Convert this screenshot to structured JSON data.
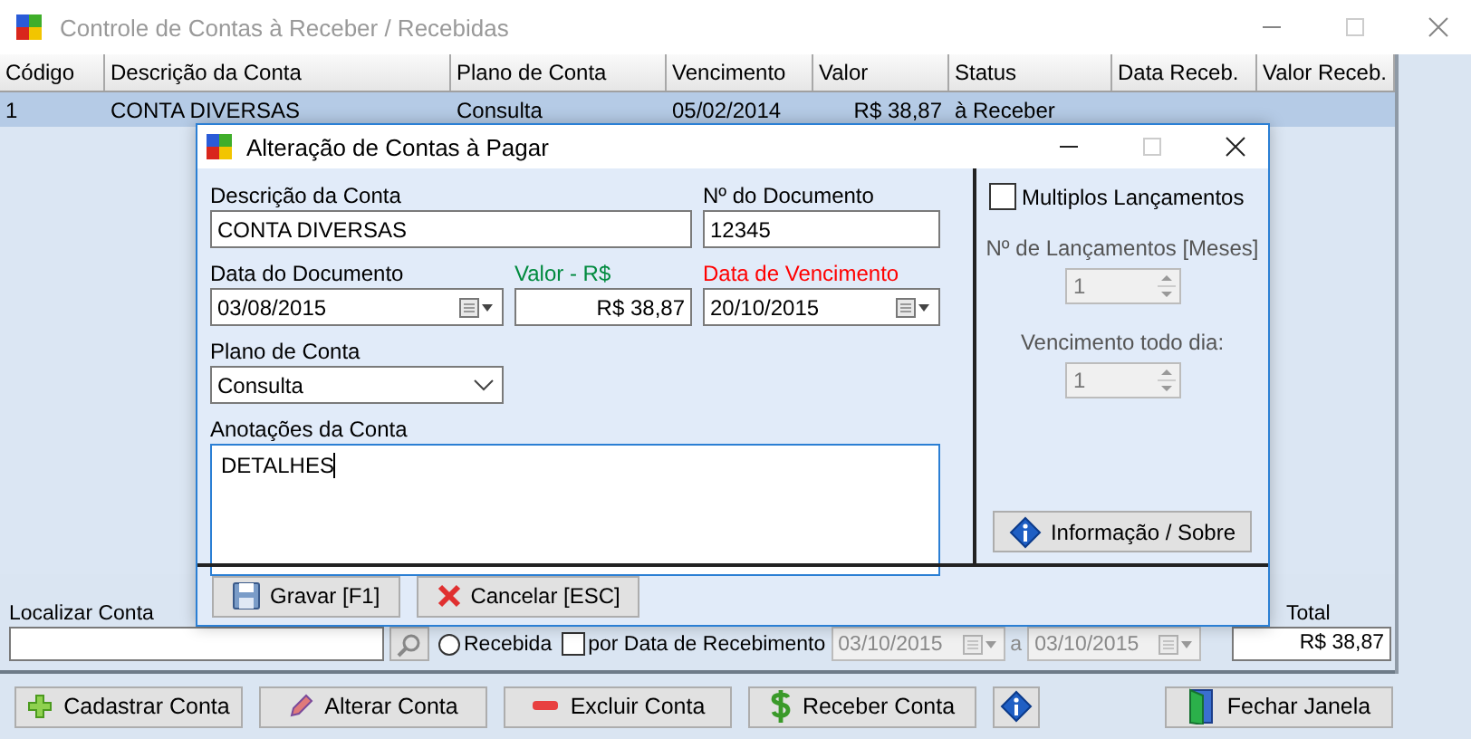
{
  "window": {
    "title": "Controle de Contas à Receber / Recebidas"
  },
  "table": {
    "columns": [
      "Código",
      "Descrição da Conta",
      "Plano de Conta",
      "Vencimento",
      "Valor",
      "Status",
      "Data Receb.",
      "Valor Receb."
    ],
    "rows": [
      {
        "cells": [
          "1",
          "CONTA DIVERSAS",
          "Consulta",
          "05/02/2014",
          "R$ 38,87",
          "à Receber",
          "",
          ""
        ],
        "selected": true
      }
    ]
  },
  "search": {
    "label": "Localizar Conta"
  },
  "filters": [
    {
      "kind": "radio",
      "label": "Recebida",
      "checked": false
    },
    {
      "kind": "checkbox",
      "label": "por Data de Recebimento",
      "checked": false
    }
  ],
  "date_range": {
    "from": "03/10/2015",
    "separator": "a",
    "to": "03/10/2015",
    "disabled": true
  },
  "total": {
    "label": "Total",
    "value": "R$ 38,87"
  },
  "buttons": [
    {
      "kind": "plus",
      "label": "Cadastrar Conta"
    },
    {
      "kind": "pencil",
      "label": "Alterar Conta"
    },
    {
      "kind": "minus",
      "label": "Excluir Conta"
    },
    {
      "kind": "dollar",
      "label": "Receber Conta"
    },
    {
      "kind": "info"
    },
    {
      "kind": "door",
      "label": "Fechar Janela"
    }
  ],
  "dialog": {
    "title": "Alteração de Contas à Pagar",
    "field_rows": [
      [
        {
          "kind": "text",
          "label": "Descrição da Conta",
          "value": "CONTA DIVERSAS",
          "color": "#000000"
        },
        {
          "kind": "text",
          "label": "Nº do Documento",
          "value": "12345",
          "color": "#000000"
        }
      ],
      [
        {
          "kind": "date",
          "label": "Data do Documento",
          "value": "03/08/2015",
          "color": "#000000"
        },
        {
          "kind": "money",
          "label": "Valor - R$",
          "value": "R$ 38,87",
          "color": "#008a3e"
        },
        {
          "kind": "date",
          "label": "Data de Vencimento",
          "value": "20/10/2015",
          "color": "#ff0000"
        }
      ],
      [
        {
          "kind": "select",
          "label": "Plano de Conta",
          "value": "Consulta",
          "color": "#000000"
        }
      ]
    ],
    "notes": {
      "label": "Anotações da Conta",
      "value": "DETALHES"
    },
    "multiple": {
      "label": "Multiplos Lançamentos",
      "checked": false
    },
    "spinners": [
      {
        "label": "Nº de Lançamentos [Meses]",
        "value": "1",
        "disabled": true
      },
      {
        "label": "Vencimento todo dia:",
        "value": "1",
        "disabled": true
      }
    ],
    "info_button": {
      "label": "Informação / Sobre"
    },
    "buttons": [
      {
        "kind": "save",
        "label": "Gravar [F1]"
      },
      {
        "kind": "cancel",
        "label": "Cancelar [ESC]"
      }
    ]
  }
}
